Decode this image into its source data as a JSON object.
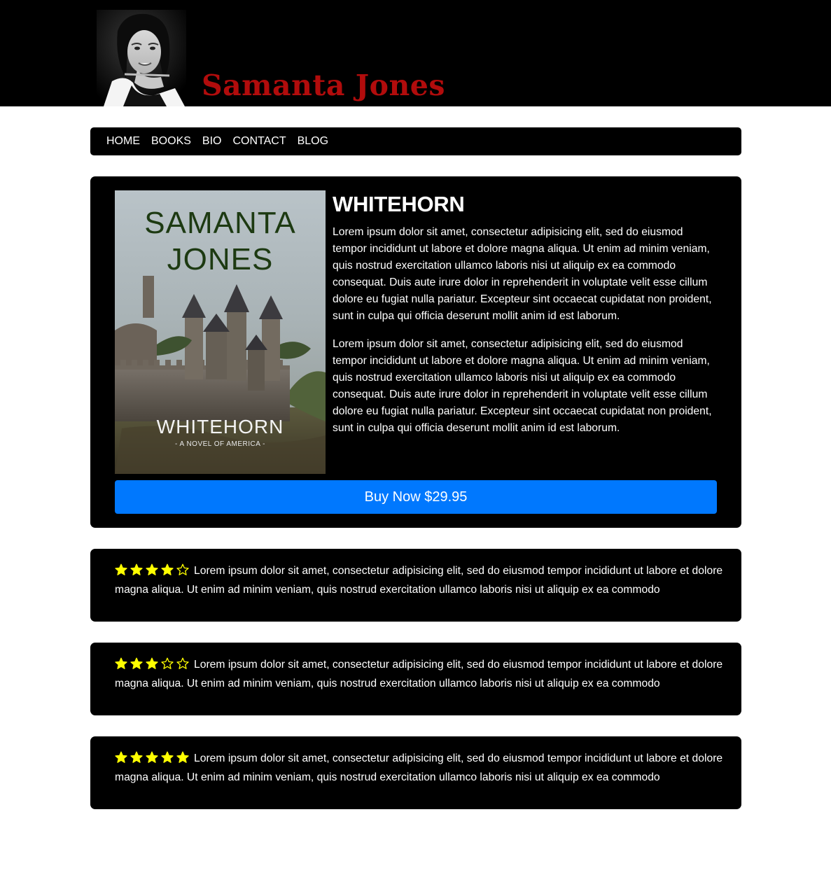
{
  "header": {
    "author_name": "Samanta Jones",
    "colors": {
      "background": "#000000",
      "name": "#b10c0c"
    }
  },
  "nav": {
    "items": [
      {
        "label": "HOME"
      },
      {
        "label": "BOOKS"
      },
      {
        "label": "BIO"
      },
      {
        "label": "CONTACT"
      },
      {
        "label": "BLOG"
      }
    ]
  },
  "book": {
    "cover": {
      "author_line_1": "SAMANTA",
      "author_line_2": "JONES",
      "title": "WHITEHORN",
      "subtitle": "- A NOVEL OF AMERICA -"
    },
    "title": "WHITEHORN",
    "paragraphs": [
      "Lorem ipsum dolor sit amet, consectetur adipisicing elit, sed do eiusmod tempor incididunt ut labore et dolore magna aliqua. Ut enim ad minim veniam, quis nostrud exercitation ullamco laboris nisi ut aliquip ex ea commodo consequat. Duis aute irure dolor in reprehenderit in voluptate velit esse cillum dolore eu fugiat nulla pariatur. Excepteur sint occaecat cupidatat non proident, sunt in culpa qui officia deserunt mollit anim id est laborum.",
      "Lorem ipsum dolor sit amet, consectetur adipisicing elit, sed do eiusmod tempor incididunt ut labore et dolore magna aliqua. Ut enim ad minim veniam, quis nostrud exercitation ullamco laboris nisi ut aliquip ex ea commodo consequat. Duis aute irure dolor in reprehenderit in voluptate velit esse cillum dolore eu fugiat nulla pariatur. Excepteur sint occaecat cupidatat non proident, sunt in culpa qui officia deserunt mollit anim id est laborum."
    ],
    "buy_label": "Buy Now $29.95",
    "colors": {
      "buy_button": "#0078fe"
    }
  },
  "reviews": [
    {
      "rating": 4,
      "max": 5,
      "text": "Lorem ipsum dolor sit amet, consectetur adipisicing elit, sed do eiusmod tempor incididunt ut labore et dolore magna aliqua. Ut enim ad minim veniam, quis nostrud exercitation ullamco laboris nisi ut aliquip ex ea commodo"
    },
    {
      "rating": 3,
      "max": 5,
      "text": "Lorem ipsum dolor sit amet, consectetur adipisicing elit, sed do eiusmod tempor incididunt ut labore et dolore magna aliqua. Ut enim ad minim veniam, quis nostrud exercitation ullamco laboris nisi ut aliquip ex ea commodo"
    },
    {
      "rating": 5,
      "max": 5,
      "text": "Lorem ipsum dolor sit amet, consectetur adipisicing elit, sed do eiusmod tempor incididunt ut labore et dolore magna aliqua. Ut enim ad minim veniam, quis nostrud exercitation ullamco laboris nisi ut aliquip ex ea commodo"
    }
  ],
  "icons": {
    "filled_star": "star-filled-icon",
    "empty_star": "star-outline-icon"
  },
  "colors": {
    "star": "#ffff00",
    "panel": "#000000"
  }
}
